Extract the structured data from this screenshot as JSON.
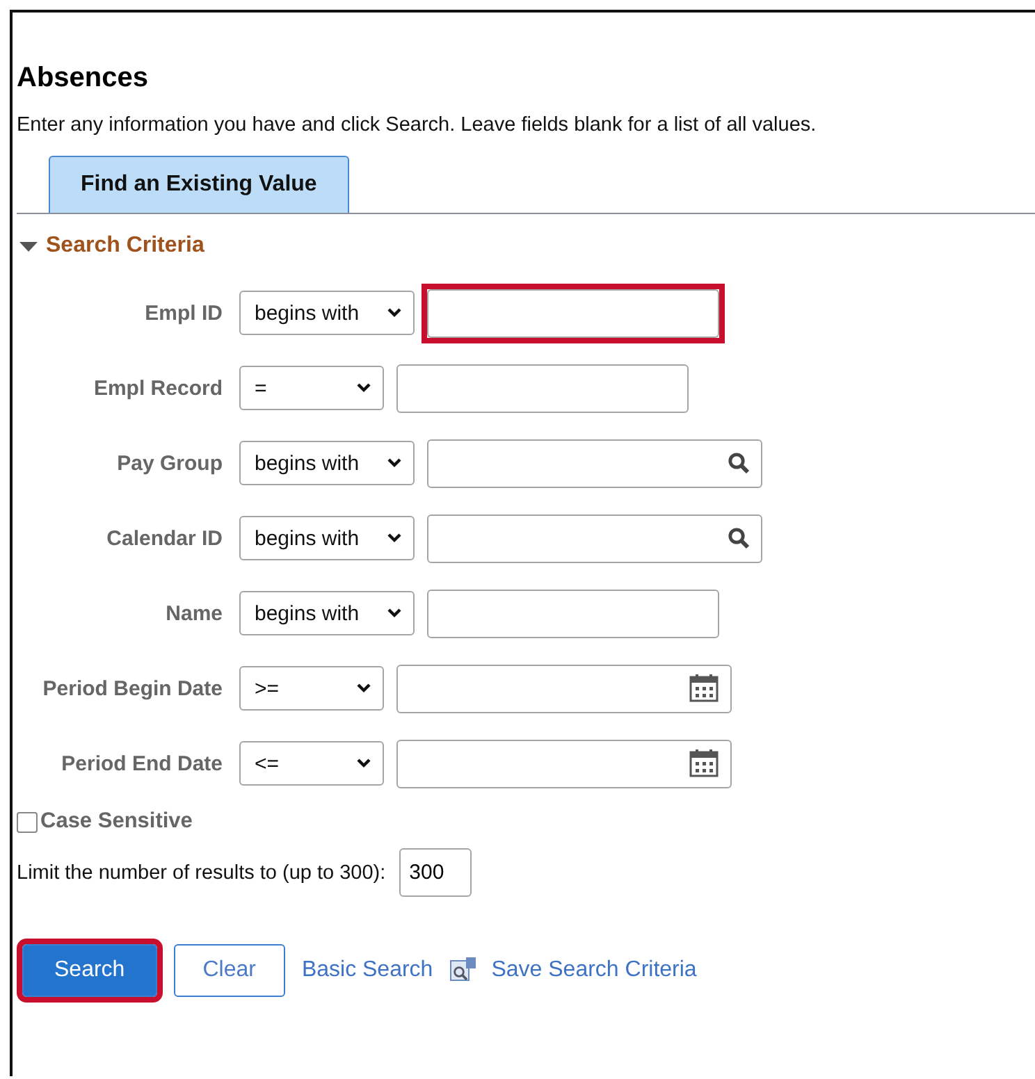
{
  "title": "Absences",
  "instructions": "Enter any information you have and click Search. Leave fields blank for a list of all values.",
  "tabs": [
    {
      "label": "Find an Existing Value",
      "selected": true
    }
  ],
  "section": {
    "label": "Search Criteria",
    "expanded": true
  },
  "criteria": [
    {
      "label": "Empl ID",
      "operator": "begins with",
      "kind": "text",
      "highlighted": true
    },
    {
      "label": "Empl Record",
      "operator": "=",
      "kind": "text",
      "highlighted": false
    },
    {
      "label": "Pay Group",
      "operator": "begins with",
      "kind": "lookup",
      "highlighted": false
    },
    {
      "label": "Calendar ID",
      "operator": "begins with",
      "kind": "lookup",
      "highlighted": false
    },
    {
      "label": "Name",
      "operator": "begins with",
      "kind": "text",
      "highlighted": false
    },
    {
      "label": "Period Begin Date",
      "operator": ">=",
      "kind": "date",
      "highlighted": false
    },
    {
      "label": "Period End Date",
      "operator": "<=",
      "kind": "date",
      "highlighted": false
    }
  ],
  "case_sensitive": {
    "label": "Case Sensitive",
    "checked": false
  },
  "limit": {
    "label": "Limit the number of results to (up to 300):",
    "value": "300"
  },
  "actions": [
    {
      "label": "Search",
      "kind": "primary",
      "highlighted": true
    },
    {
      "label": "Clear",
      "kind": "secondary",
      "highlighted": false
    },
    {
      "label": "Basic Search",
      "kind": "link",
      "highlighted": false
    },
    {
      "label": "Save Search Criteria",
      "kind": "icon-link",
      "highlighted": false
    }
  ]
}
